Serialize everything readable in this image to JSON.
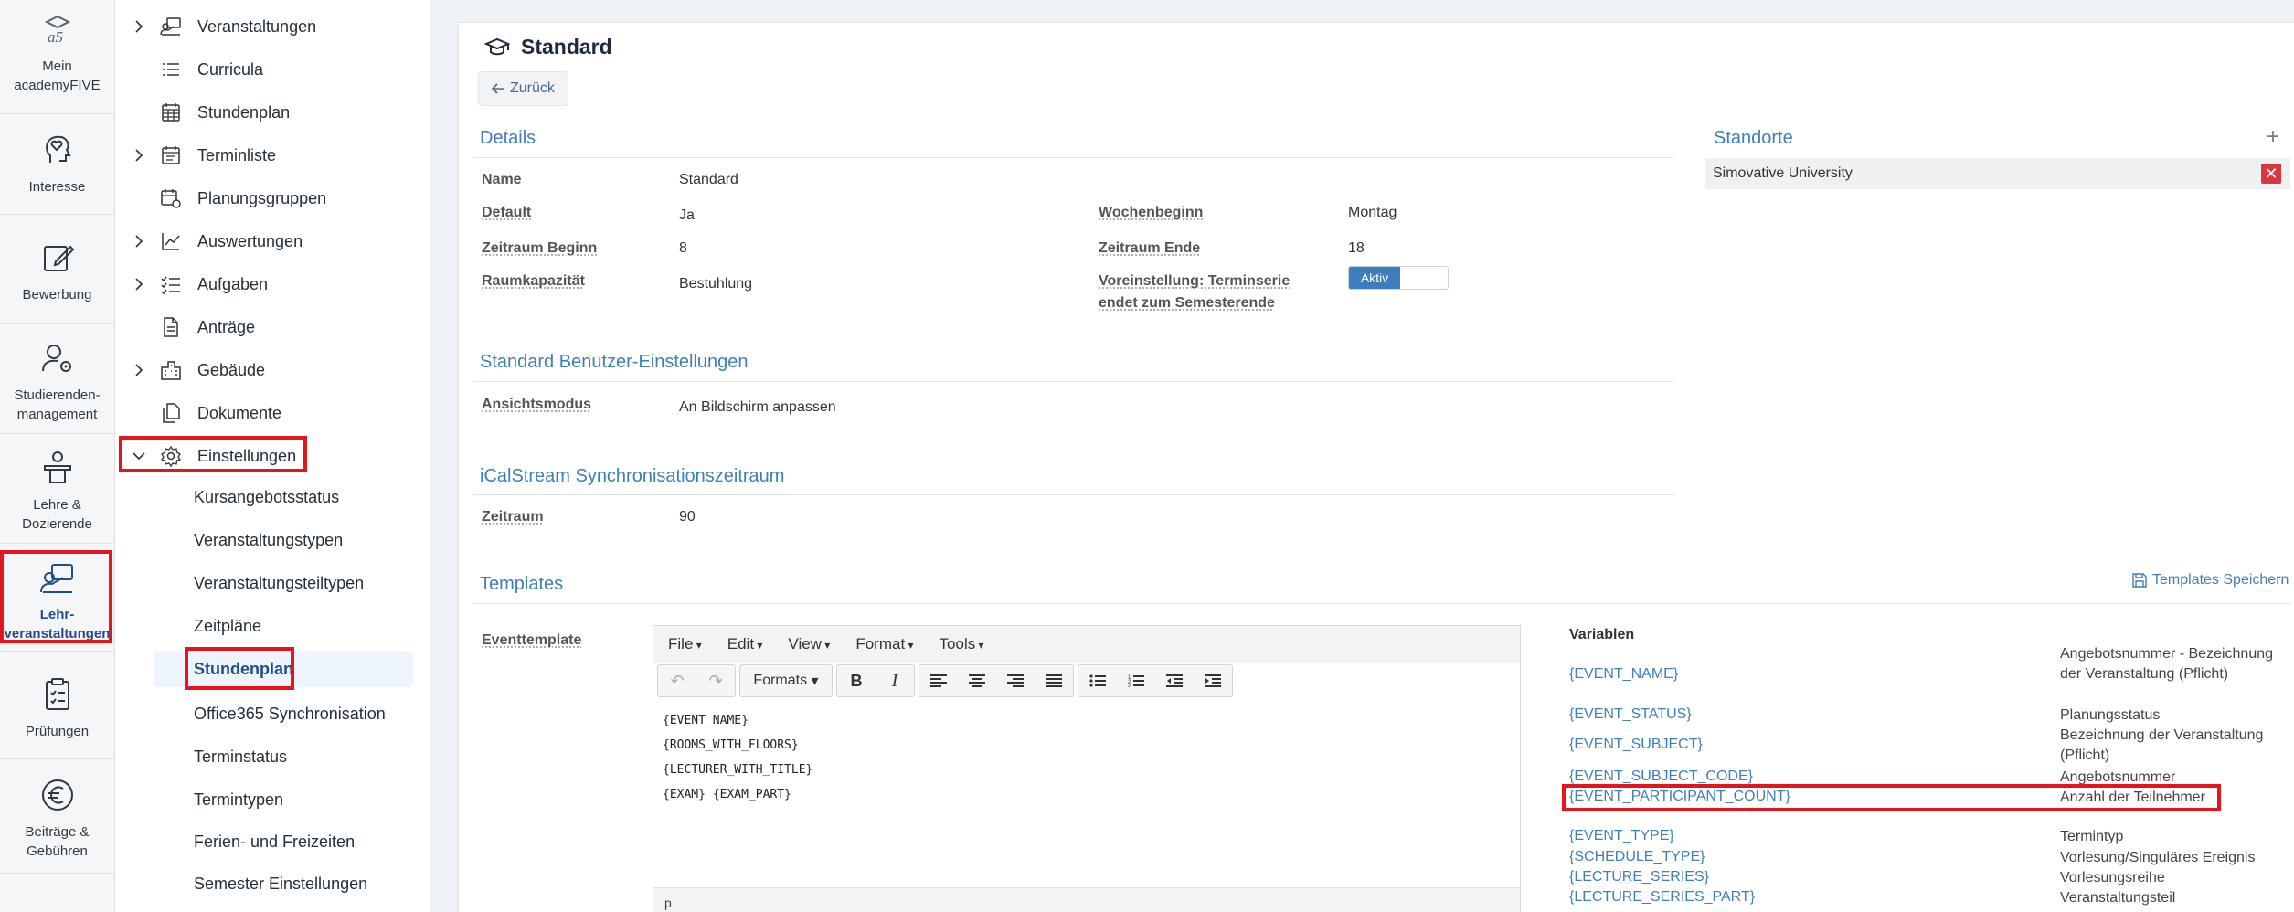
{
  "rail": {
    "items": [
      {
        "label": "Mein academyFIVE",
        "icon": "academyfive-logo-icon"
      },
      {
        "label": "Interesse",
        "icon": "heart-head-icon"
      },
      {
        "label": "Bewerbung",
        "icon": "edit-note-icon"
      },
      {
        "label": "Studierenden-management",
        "icon": "user-gear-icon"
      },
      {
        "label": "Lehre & Dozierende",
        "icon": "lectern-icon"
      },
      {
        "label": "Lehr-veranstaltungen",
        "icon": "teaching-icon"
      },
      {
        "label": "Prüfungen",
        "icon": "clipboard-icon"
      },
      {
        "label": "Beiträge & Gebühren",
        "icon": "euro-icon"
      }
    ]
  },
  "nav": {
    "items": [
      {
        "label": "Veranstaltungen",
        "icon": "person-board-icon",
        "expandable": true
      },
      {
        "label": "Curricula",
        "icon": "list-icon",
        "expandable": false
      },
      {
        "label": "Stundenplan",
        "icon": "calendar-grid-icon",
        "expandable": false
      },
      {
        "label": "Terminliste",
        "icon": "calendar-list-icon",
        "expandable": true
      },
      {
        "label": "Planungsgruppen",
        "icon": "calendar-gear-icon",
        "expandable": false
      },
      {
        "label": "Auswertungen",
        "icon": "chart-line-icon",
        "expandable": true
      },
      {
        "label": "Aufgaben",
        "icon": "checklist-icon",
        "expandable": true
      },
      {
        "label": "Anträge",
        "icon": "document-icon",
        "expandable": false
      },
      {
        "label": "Gebäude",
        "icon": "building-icon",
        "expandable": true
      },
      {
        "label": "Dokumente",
        "icon": "documents-icon",
        "expandable": false
      },
      {
        "label": "Einstellungen",
        "icon": "gear-icon",
        "expandable": true
      }
    ],
    "sub_items": [
      "Kursangebotsstatus",
      "Veranstaltungstypen",
      "Veranstaltungsteiltypen",
      "Zeitpläne",
      "Stundenplan",
      "Office365 Synchronisation",
      "Terminstatus",
      "Termintypen",
      "Ferien- und Freizeiten",
      "Semester Einstellungen"
    ]
  },
  "page": {
    "title": "Standard",
    "back_label": "Zurück"
  },
  "details": {
    "heading": "Details",
    "name_label": "Name",
    "name_value": "Standard",
    "default_label": "Default",
    "default_value": "Ja",
    "start_label": "Zeitraum Beginn",
    "start_value": "8",
    "room_label": "Raumkapazität",
    "room_value": "Bestuhlung",
    "week_label": "Wochenbeginn",
    "week_value": "Montag",
    "end_label": "Zeitraum Ende",
    "end_value": "18",
    "preset_label_1": "Voreinstellung: Terminserie",
    "preset_label_2": "endet zum Semesterende",
    "preset_toggle": "Aktiv"
  },
  "locations": {
    "heading": "Standorte",
    "add": "+",
    "items": [
      "Simovative University"
    ],
    "remove": "✕"
  },
  "user_settings": {
    "heading": "Standard Benutzer-Einstellungen",
    "view_label": "Ansichtsmodus",
    "view_value": "An Bildschirm anpassen"
  },
  "ical": {
    "heading": "iCalStream Synchronisationszeitraum",
    "range_label": "Zeitraum",
    "range_value": "90"
  },
  "templates": {
    "heading": "Templates",
    "save_label": "Templates Speichern",
    "event_label": "Eventtemplate",
    "menu": [
      "File",
      "Edit",
      "View",
      "Format",
      "Tools"
    ],
    "formats_label": "Formats",
    "content_lines": [
      "{EVENT_NAME}",
      "{ROOMS_WITH_FLOORS}",
      "{LECTURER_WITH_TITLE}",
      "{EXAM} {EXAM_PART}"
    ],
    "status_path": "p"
  },
  "variables": {
    "heading": "Variablen",
    "rows": [
      {
        "name": "{EVENT_NAME}",
        "desc": "Angebotsnummer - Bezeichnung der Veranstaltung (Pflicht)"
      },
      {
        "name": "{EVENT_STATUS}",
        "desc": "Planungsstatus"
      },
      {
        "name": "{EVENT_SUBJECT}",
        "desc": "Bezeichnung der Veranstaltung (Pflicht)"
      },
      {
        "name": "{EVENT_SUBJECT_CODE}",
        "desc": "Angebotsnummer"
      },
      {
        "name": "{EVENT_PARTICIPANT_COUNT}",
        "desc": "Anzahl der Teilnehmer"
      },
      {
        "name": "{EVENT_TYPE}",
        "desc": "Termintyp"
      },
      {
        "name": "{SCHEDULE_TYPE}",
        "desc": "Vorlesung/Singuläres Ereignis"
      },
      {
        "name": "{LECTURE_SERIES}",
        "desc": "Vorlesungsreihe"
      },
      {
        "name": "{LECTURE_SERIES_PART}",
        "desc": "Veranstaltungsteil"
      }
    ]
  },
  "colors": {
    "accent": "#3f7fb6",
    "highlight": "#e3151f",
    "toggle_on": "#3e7dbd",
    "danger": "#d9363e"
  }
}
